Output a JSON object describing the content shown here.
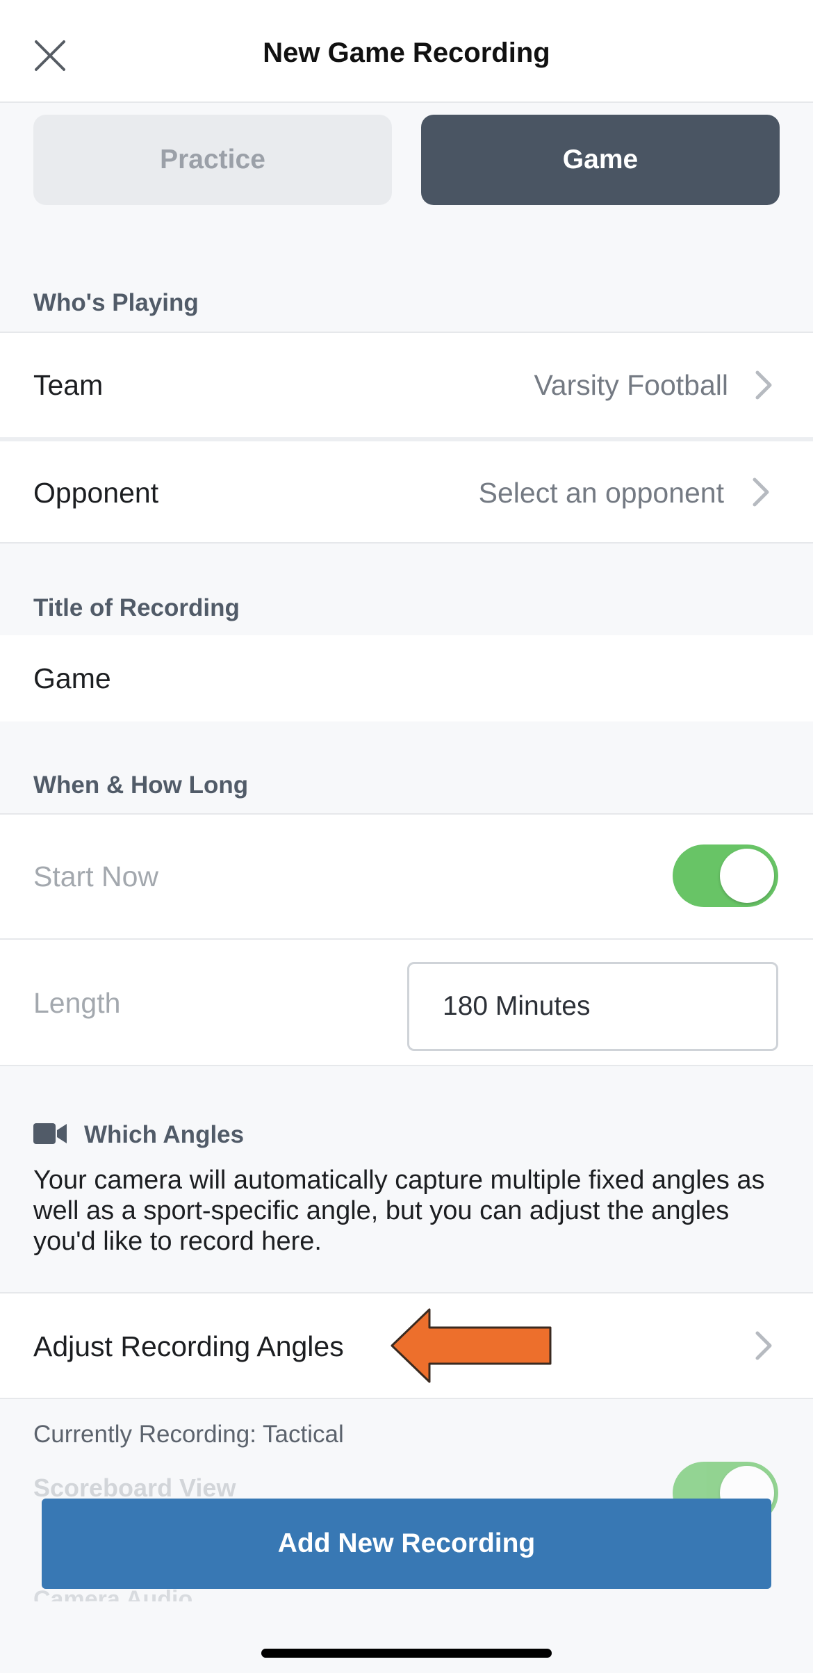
{
  "header": {
    "title": "New Game Recording",
    "close_icon": "close-icon"
  },
  "mode": {
    "options": [
      "Practice",
      "Game"
    ],
    "selected": "Game"
  },
  "whos_playing": {
    "label": "Who's Playing",
    "team": {
      "label": "Team",
      "value": "Varsity Football"
    },
    "opponent": {
      "label": "Opponent",
      "value": "Select an opponent"
    }
  },
  "title_section": {
    "label": "Title of Recording",
    "value": "Game"
  },
  "when": {
    "label": "When & How Long",
    "start_now": {
      "label": "Start Now",
      "on": true
    },
    "length": {
      "label": "Length",
      "value": "180 Minutes"
    }
  },
  "angles": {
    "label": "Which Angles",
    "icon": "video-camera-icon",
    "description": "Your camera will automatically capture multiple fixed angles as well as a sport-specific angle, but you can adjust the angles you'd like to record here.",
    "adjust_label": "Adjust Recording Angles",
    "currently": "Currently Recording: Tactical",
    "scoreboard_label": "Scoreboard View",
    "audio_label": "Camera Audio"
  },
  "footer": {
    "button_label": "Add New Recording"
  },
  "colors": {
    "accent": "#3878b4",
    "toggle_on": "#68c466",
    "selected_segment": "#4a5563",
    "arrow": "#ed6f2c"
  }
}
